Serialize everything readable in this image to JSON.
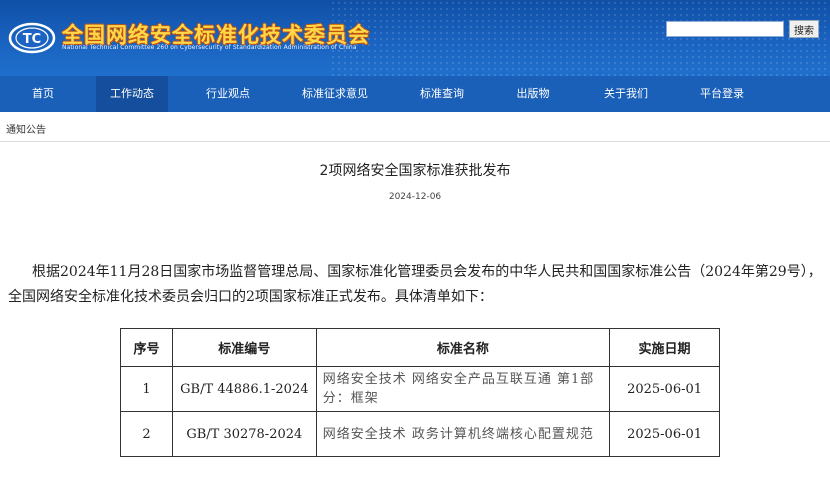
{
  "header": {
    "site_title": "全国网络安全标准化技术委员会",
    "site_subtitle": "National Technical Committee 260 on Cybersecurity of Standardization Administration of China",
    "search_placeholder": "",
    "search_label": "搜索"
  },
  "nav": {
    "items": [
      {
        "label": "首页"
      },
      {
        "label": "工作动态"
      },
      {
        "label": "行业观点"
      },
      {
        "label": "标准征求意见"
      },
      {
        "label": "标准查询"
      },
      {
        "label": "出版物"
      },
      {
        "label": "关于我们"
      },
      {
        "label": "平台登录"
      }
    ],
    "active": "工作动态"
  },
  "breadcrumb": "通知公告",
  "article": {
    "title": "2项网络安全国家标准获批发布",
    "date": "2024-12-06",
    "body": "根据2024年11月28日国家市场监督管理总局、国家标准化管理委员会发布的中华人民共和国国家标准公告（2024年第29号），全国网络安全标准化技术委员会归口的2项国家标准正式发布。具体清单如下："
  },
  "table": {
    "headers": [
      "序号",
      "标准编号",
      "标准名称",
      "实施日期"
    ],
    "rows": [
      [
        "1",
        "GB/T 44886.1-2024",
        "网络安全技术 网络安全产品互联互通 第1部分：框架",
        "2025-06-01"
      ],
      [
        "2",
        "GB/T 30278-2024",
        "网络安全技术 政务计算机终端核心配置规范",
        "2025-06-01"
      ]
    ]
  },
  "colors": {
    "banner": "#1a63c0",
    "nav": "#1a5fb8",
    "nav_active": "#154e9c",
    "title_text": "#ffd84a"
  }
}
